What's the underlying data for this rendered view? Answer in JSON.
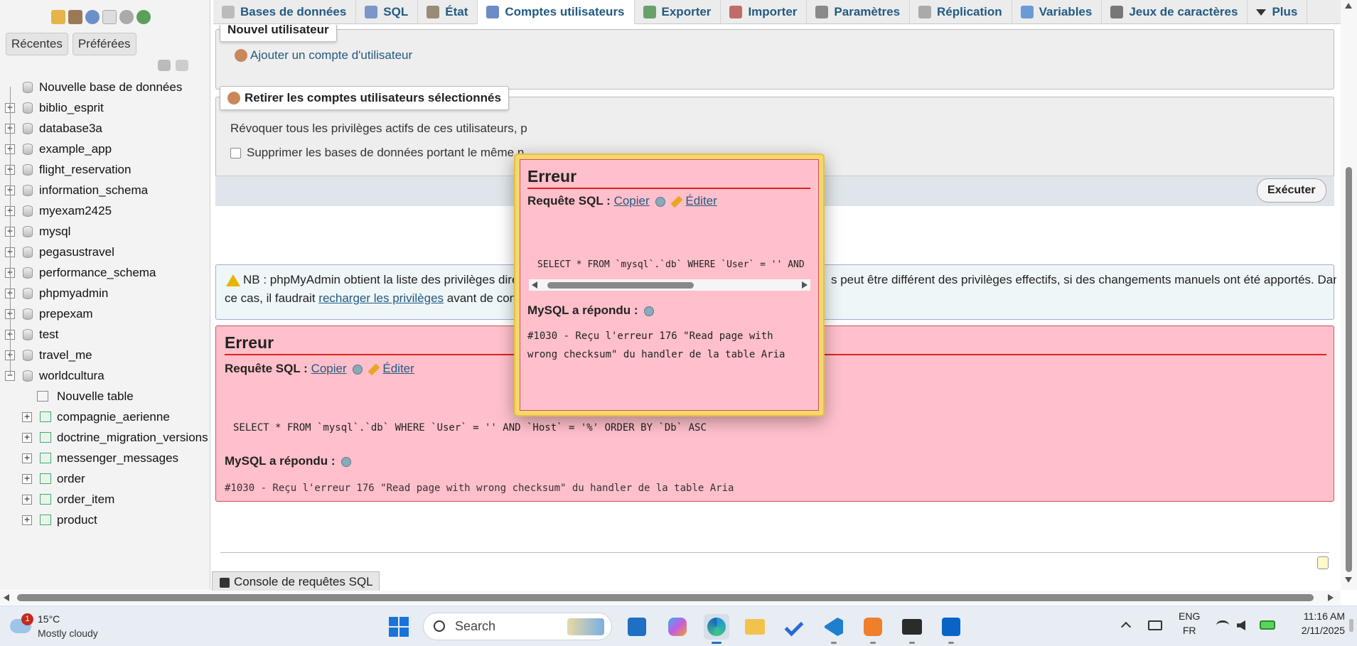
{
  "nav": {
    "tabs": [
      "Récentes",
      "Préférées"
    ],
    "tree": [
      {
        "label": "Nouvelle base de données",
        "kind": "new"
      },
      {
        "label": "biblio_esprit",
        "kind": "db"
      },
      {
        "label": "database3a",
        "kind": "db"
      },
      {
        "label": "example_app",
        "kind": "db"
      },
      {
        "label": "flight_reservation",
        "kind": "db"
      },
      {
        "label": "information_schema",
        "kind": "db"
      },
      {
        "label": "myexam2425",
        "kind": "db"
      },
      {
        "label": "mysql",
        "kind": "db"
      },
      {
        "label": "pegasustravel",
        "kind": "db"
      },
      {
        "label": "performance_schema",
        "kind": "db"
      },
      {
        "label": "phpmyadmin",
        "kind": "db"
      },
      {
        "label": "prepexam",
        "kind": "db"
      },
      {
        "label": "test",
        "kind": "db"
      },
      {
        "label": "travel_me",
        "kind": "db"
      },
      {
        "label": "worldcultura",
        "kind": "db-open"
      }
    ],
    "worldcultura_children": [
      {
        "label": "Nouvelle table",
        "kind": "new"
      },
      {
        "label": "compagnie_aerienne",
        "kind": "table"
      },
      {
        "label": "doctrine_migration_versions",
        "kind": "table"
      },
      {
        "label": "messenger_messages",
        "kind": "table"
      },
      {
        "label": "order",
        "kind": "table"
      },
      {
        "label": "order_item",
        "kind": "table"
      },
      {
        "label": "product",
        "kind": "table"
      }
    ]
  },
  "topbar": {
    "tabs": [
      {
        "label": "Bases de données",
        "icon": "database-icon",
        "active": false
      },
      {
        "label": "SQL",
        "icon": "sql-icon",
        "active": false
      },
      {
        "label": "État",
        "icon": "status-icon",
        "active": false
      },
      {
        "label": "Comptes utilisateurs",
        "icon": "users-icon",
        "active": true
      },
      {
        "label": "Exporter",
        "icon": "export-icon",
        "active": false
      },
      {
        "label": "Importer",
        "icon": "import-icon",
        "active": false
      },
      {
        "label": "Paramètres",
        "icon": "wrench-icon",
        "active": false
      },
      {
        "label": "Réplication",
        "icon": "replication-icon",
        "active": false
      },
      {
        "label": "Variables",
        "icon": "variables-icon",
        "active": false
      },
      {
        "label": "Jeux de caractères",
        "icon": "charset-icon",
        "active": false
      },
      {
        "label": "Plus",
        "icon": "chevron-down-icon",
        "active": false
      }
    ]
  },
  "main": {
    "new_user_legend": "Nouvel utilisateur",
    "add_account_link": "Ajouter un compte d'utilisateur",
    "remove_legend": "Retirer les comptes utilisateurs sélectionnés",
    "revoke_text": "Révoquer tous les privilèges actifs de ces utilisateurs, p",
    "drop_db_label": "Supprimer les bases de données portant le même n",
    "execute_button": "Exécuter",
    "notice_line1_a": "NB : phpMyAdmin obtient la liste des privilèges direc",
    "notice_line1_b": "s peut être différent des privilèges effectifs, si des changements manuels ont été apportés. Dans",
    "notice_line2_a": "ce cas, il faudrait ",
    "notice_link": "recharger les privilèges",
    "notice_line2_b": " avant de conti",
    "error": {
      "title": "Erreur",
      "query_label": "Requête SQL :",
      "copy_link": "Copier",
      "edit_link": "Éditer",
      "query": "SELECT * FROM `mysql`.`db` WHERE `User` = '' AND `Host` = '%' ORDER BY `Db` ASC",
      "response_label": "MySQL a répondu :",
      "response": "#1030 - Reçu l'erreur 176 \"Read page with wrong checksum\" du handler de la table Aria"
    },
    "console_label": "Console de requêtes SQL"
  },
  "modal": {
    "title": "Erreur",
    "query_label": "Requête SQL :",
    "copy_link": "Copier",
    "edit_link": "Éditer",
    "query_visible": "SELECT * FROM `mysql`.`db` WHERE `User` = '' AND",
    "response_label": "MySQL a répondu :",
    "response_line1": "#1030 - Reçu l'erreur 176 \"Read page with",
    "response_line2": "wrong checksum\" du handler de la table Aria"
  },
  "taskbar": {
    "weather_temp": "15°C",
    "weather_desc": "Mostly cloudy",
    "weather_badge": "1",
    "search_placeholder": "Search",
    "lang_top": "ENG",
    "lang_bottom": "FR",
    "time": "11:16 AM",
    "date": "2/11/2025"
  }
}
